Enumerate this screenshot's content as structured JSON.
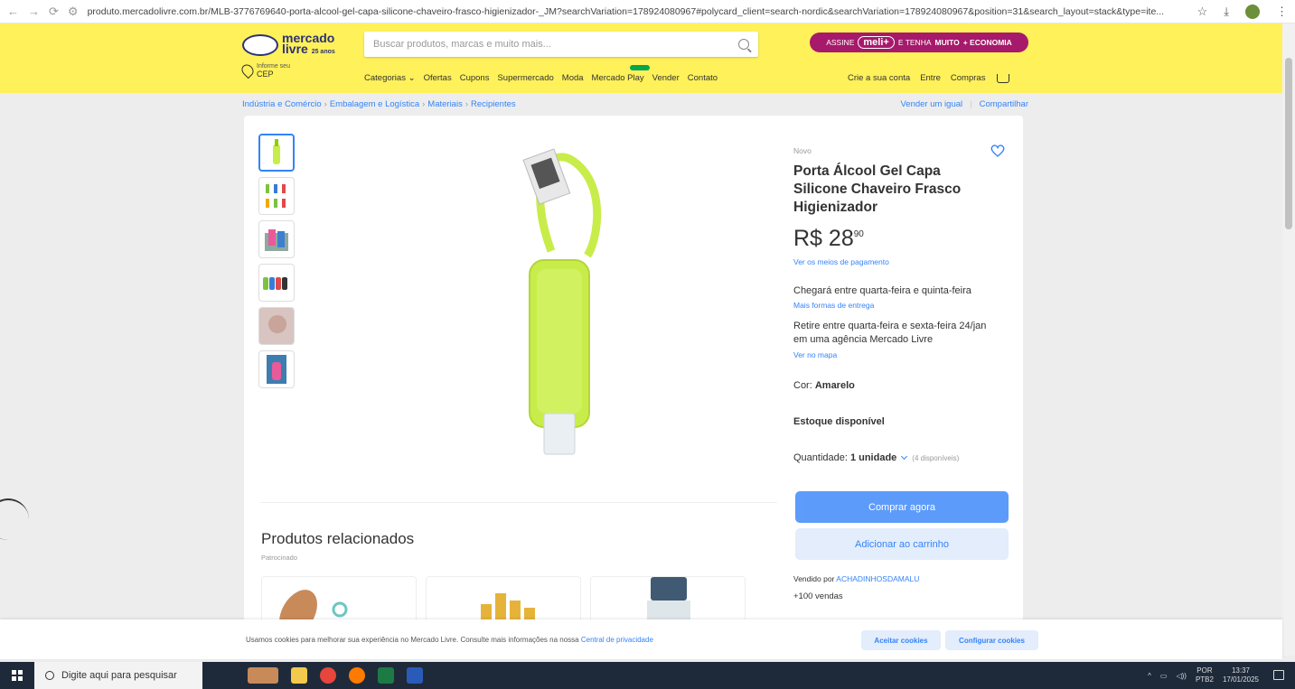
{
  "browser": {
    "url": "produto.mercadolivre.com.br/MLB-3776769640-porta-alcool-gel-capa-silicone-chaveiro-frasco-higienizador-_JM?searchVariation=178924080967#polycard_client=search-nordic&searchVariation=178924080967&position=31&search_layout=stack&type=ite..."
  },
  "header": {
    "logo_line1": "mercado",
    "logo_line2": "livre",
    "logo_badge": "25 anos",
    "cep_label": "Informe seu",
    "cep_value": "CEP",
    "search_placeholder": "Buscar produtos, marcas e muito mais...",
    "promo": {
      "assine": "ASSINE",
      "meli": "meli+",
      "tenha": "E TENHA",
      "muito": "MUITO",
      "economia": "+ ECONOMIA"
    },
    "nav": [
      "Categorias",
      "Ofertas",
      "Cupons",
      "Supermercado",
      "Moda",
      "Mercado Play",
      "Vender",
      "Contato"
    ],
    "user_nav": [
      "Crie a sua conta",
      "Entre",
      "Compras"
    ]
  },
  "breadcrumb": [
    "Indústria e Comércio",
    "Embalagem e Logística",
    "Materiais",
    "Recipientes"
  ],
  "share": {
    "sell": "Vender um igual",
    "share": "Compartilhar"
  },
  "product": {
    "condition": "Novo",
    "title": "Porta Álcool Gel Capa Silicone Chaveiro Frasco Higienizador",
    "price_currency": "R$",
    "price_int": "28",
    "price_cents": "90",
    "payment_link": "Ver os meios de pagamento",
    "shipping1": "Chegará entre quarta-feira e quinta-feira",
    "shipping1_link": "Mais formas de entrega",
    "shipping2": "Retire entre quarta-feira e sexta-feira 24/jan em uma agência Mercado Livre",
    "shipping2_link": "Ver no mapa",
    "color_label": "Cor:",
    "color_value": "Amarelo",
    "stock": "Estoque disponível",
    "qty_label": "Quantidade:",
    "qty_value": "1 unidade",
    "qty_avail": "(4 disponíveis)",
    "buy_now": "Comprar agora",
    "add_cart": "Adicionar ao carrinho",
    "seller_label": "Vendido por",
    "seller_name": "ACHADINHOSDAMALU",
    "sales": "+100 vendas"
  },
  "related": {
    "title": "Produtos relacionados",
    "sponsored": "Patrocinado"
  },
  "cookie": {
    "text": "Usamos cookies para melhorar sua experiência no Mercado Livre. Consulte mais informações na nossa",
    "link": "Central de privacidade",
    "accept": "Aceitar cookies",
    "configure": "Configurar cookies"
  },
  "taskbar": {
    "search": "Digite aqui para pesquisar",
    "lang1": "POR",
    "lang2": "PTB2",
    "time": "13:37",
    "date": "17/01/2025"
  },
  "colors": {
    "header_yellow": "#fff159",
    "brand_blue": "#3483fa",
    "meli_purple": "#a7196b",
    "product_green": "#c8ec4a"
  }
}
